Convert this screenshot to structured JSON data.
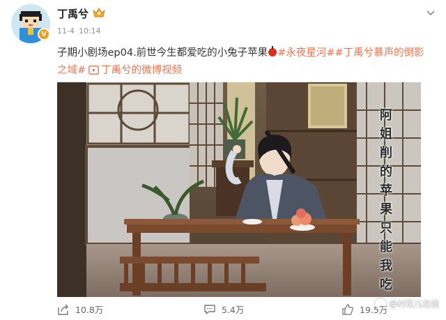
{
  "post": {
    "author": "丁禹兮",
    "date": "11-4",
    "time": "10:14",
    "text_prefix": "子期小剧场ep04.前世今生都爱吃的小兔子苹果",
    "topics": [
      "#永夜星河#",
      "#丁禹兮慕声的倒影之域#"
    ],
    "video_link": "丁禹兮的微博视频"
  },
  "media": {
    "caption": "阿姐削的苹果只能我吃"
  },
  "actions": {
    "share": "10.8万",
    "comment": "5.4万",
    "like": "19.5万"
  },
  "watermark": "@村花儿在线",
  "colors": {
    "link": "#eb7350",
    "verified_badge": "#f29b16",
    "meta": "#939393"
  },
  "icons": [
    "verified-icon",
    "crown-badge-icon",
    "chevron-down-icon",
    "apple-emoji-icon",
    "video-icon",
    "share-icon",
    "comment-icon",
    "like-icon"
  ]
}
